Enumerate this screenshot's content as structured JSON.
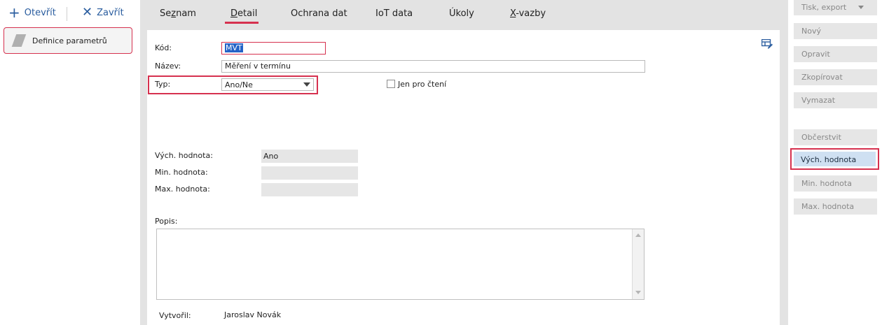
{
  "toolbar": {
    "open_label": "Otevřít",
    "close_label": "Zavřít"
  },
  "sidebar": {
    "items": [
      {
        "label": "Definice parametrů",
        "icon": "parallelogram-icon"
      }
    ]
  },
  "tabs": [
    {
      "label": "Seznam",
      "hotkey": "z",
      "active": false
    },
    {
      "label": "Detail",
      "hotkey": "D",
      "active": true
    },
    {
      "label": "Ochrana dat",
      "active": false
    },
    {
      "label": "IoT data",
      "active": false
    },
    {
      "label": "Úkoly",
      "active": false
    },
    {
      "label": "X-vazby",
      "hotkey": "X",
      "active": false
    }
  ],
  "form": {
    "kod_label": "Kód:",
    "kod_value": "MVT",
    "nazev_label": "Název:",
    "nazev_value": "Měření v termínu",
    "typ_label": "Typ:",
    "typ_value": "Ano/Ne",
    "readonly_label": "Jen pro čtení",
    "readonly_checked": false,
    "vych_label": "Vých. hodnota:",
    "vych_value": "Ano",
    "min_label": "Min. hodnota:",
    "min_value": "",
    "max_label": "Max. hodnota:",
    "max_value": "",
    "popis_label": "Popis:",
    "popis_value": "",
    "vytvoril_label": "Vytvořil:",
    "vytvoril_value": "Jaroslav Novák"
  },
  "actions": {
    "tisk": "Tisk, export",
    "novy": "Nový",
    "opravit": "Opravit",
    "zkopirovat": "Zkopírovat",
    "vymazat": "Vymazat",
    "obcerstvit": "Občerstvit",
    "vych": "Vých. hodnota",
    "min": "Min. hodnota",
    "max": "Max. hodnota"
  },
  "colors": {
    "accent": "#d6314f",
    "link": "#2a5d9f",
    "selected_button": "#cfe0f2"
  }
}
